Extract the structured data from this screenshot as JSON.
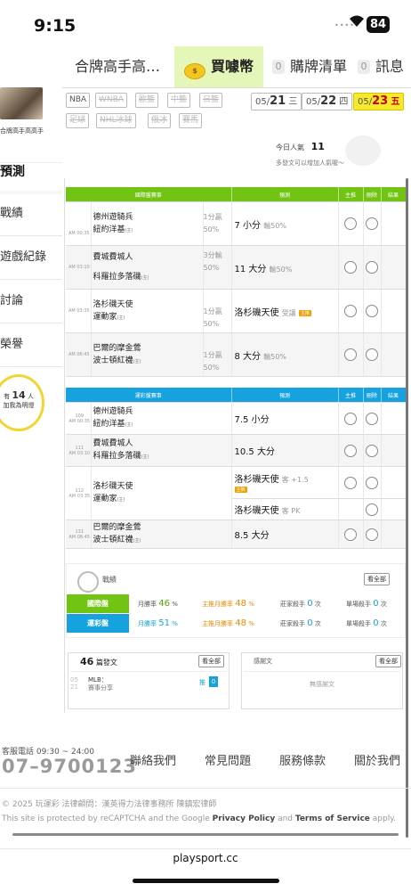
{
  "status": {
    "time": "9:15",
    "battery": "84"
  },
  "topnav": {
    "tabs": [
      {
        "label": "合牌高手高…"
      },
      {
        "label": "買噱幣"
      },
      {
        "badge": "0",
        "label": "購牌清單"
      },
      {
        "badge": "0",
        "label": "訊息"
      }
    ]
  },
  "sidebar": {
    "nickname": "合牌高手高高手",
    "current": "預測",
    "items": [
      "戰績",
      "遊戲紀錄",
      "討論",
      "榮譽"
    ],
    "fans": {
      "prefix": "有",
      "count": "14",
      "suffix": "人",
      "line2": "加我為明燈"
    }
  },
  "leagues": {
    "row1": [
      {
        "label": "NBA",
        "enabled": true
      },
      {
        "label": "WNBA",
        "enabled": false
      },
      {
        "label": "歐籃",
        "enabled": false
      },
      {
        "label": "中籃",
        "enabled": false
      },
      {
        "label": "日籃",
        "enabled": false
      }
    ],
    "row2": [
      {
        "label": "足球",
        "enabled": false
      },
      {
        "label": "NHL冰球",
        "enabled": false
      },
      {
        "label": "俄冰",
        "enabled": false
      },
      {
        "label": "賽馬",
        "enabled": false
      }
    ]
  },
  "dates": [
    {
      "md": "05/",
      "d": "21",
      "w": "三"
    },
    {
      "md": "05/",
      "d": "22",
      "w": "四"
    },
    {
      "md": "05/",
      "d": "23",
      "w": "五"
    }
  ],
  "popularity": {
    "label": "今日人氣",
    "value": "11",
    "hint": "多發文可以增加人氣喔～"
  },
  "intl_table": {
    "headers": [
      "國際盤賽事",
      "預測",
      "主推",
      "刪除",
      "結果"
    ],
    "rows": [
      {
        "time": "AM 00:35",
        "team1": "德州遊騎兵",
        "team2": "紐約洋基",
        "team2_tag": "(主)",
        "odds1": "",
        "odds2": "1分贏",
        "odds3": "50%",
        "pick": "7 小分",
        "pick_sub": "輸50%"
      },
      {
        "time": "AM 03:10",
        "team1": "費城費城人",
        "team2": "科羅拉多落磯",
        "team2_tag": "(主)",
        "odds1": "3分輸",
        "odds2": "50%",
        "odds3": "",
        "pick": "11 大分",
        "pick_sub": "輸50%"
      },
      {
        "time": "AM 03:35",
        "team1": "洛杉磯天使",
        "team2": "運動家",
        "team2_tag": "(主)",
        "odds1": "",
        "odds2": "1分贏",
        "odds3": "50%",
        "pick": "洛杉磯天使",
        "pick_sub": "受讓",
        "pick_tag": "主推"
      },
      {
        "time": "AM 06:45",
        "team1": "巴爾的摩金鶯",
        "team2": "波士頓紅襪",
        "team2_tag": "(主)",
        "odds1": "",
        "odds2": "1分贏",
        "odds3": "50%",
        "pick": "8 大分",
        "pick_sub": "輸50%"
      }
    ]
  },
  "lottery_table": {
    "headers": [
      "運彩盤賽事",
      "預測",
      "主推",
      "刪除",
      "結果"
    ],
    "rows": [
      {
        "num": "109",
        "time": "AM 00:35",
        "team1": "德州遊騎兵",
        "team2": "紐約洋基",
        "team2_tag": "(主)",
        "pick": "7.5 小分",
        "pick_sub": ""
      },
      {
        "num": "111",
        "time": "AM 03:10",
        "team1": "費城費城人",
        "team2": "科羅拉多落磯",
        "team2_tag": "(主)",
        "pick": "10.5 大分",
        "pick_sub": ""
      },
      {
        "num": "112",
        "time": "AM 03:35",
        "team1": "洛杉磯天使",
        "team2": "運動家",
        "team2_tag": "(主)",
        "pick": "洛杉磯天使",
        "pick_sub": "客 +1.5",
        "pick_tag": "主推",
        "pick2": "洛杉磯天使",
        "pick2_sub": "客 PK"
      },
      {
        "num": "131",
        "time": "AM 06:45",
        "team1": "巴爾的摩金鶯",
        "team2": "波士頓紅襪",
        "team2_tag": "(主)",
        "pick": "8.5 大分",
        "pick_sub": ""
      }
    ]
  },
  "record": {
    "title": "戰績",
    "see_all": "看全部",
    "rows": [
      {
        "league": "國際盤",
        "color": "#72c414",
        "win_label": "月勝率",
        "win": "46",
        "main_label": "主推月勝率",
        "main": "48",
        "pct": "%",
        "host_label": "莊家殺手",
        "host": "0",
        "single_label": "單場殺手",
        "single": "0",
        "unit": "次"
      },
      {
        "league": "運彩盤",
        "color": "#16a2de",
        "win_label": "月勝率",
        "win": "51",
        "main_label": "主推月勝率",
        "main": "48",
        "pct": "%",
        "host_label": "莊家殺手",
        "host": "0",
        "single_label": "單場殺手",
        "single": "0",
        "unit": "次"
      }
    ]
  },
  "posts": {
    "count": "46",
    "label": "篇發文",
    "see_all": "看全部",
    "date_top": "05",
    "date_bot": "21",
    "title": "MLB：",
    "subtitle": "賽事分享",
    "push": "推",
    "push_count": "0"
  },
  "thanks": {
    "title": "感謝文",
    "see_all": "看全部",
    "empty": "無感謝文"
  },
  "footer": {
    "svc": "客服電話 09:30 ~ 24:00",
    "phone": "07–9700123",
    "links": [
      "聯絡我們",
      "常見問題",
      "服務條款",
      "關於我們"
    ],
    "copyright": "© 2025 玩運彩 法律顧問：漢英得力法律事務所 陳鎮宏律師",
    "captcha_pre": "This site is protected by reCAPTCHA and the Google ",
    "privacy": "Privacy Policy",
    "and": " and ",
    "terms": "Terms of Service",
    "apply": " apply."
  },
  "url": "playsport.cc"
}
